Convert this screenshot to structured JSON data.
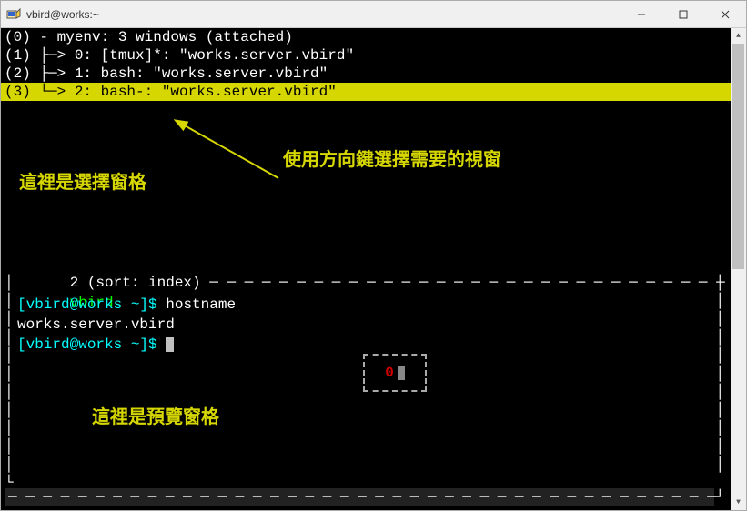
{
  "titlebar": {
    "title": "vbird@works:~"
  },
  "tmux": {
    "session_line": "(0) - myenv: 3 windows (attached)",
    "windows": [
      "(1) ├─> 0: [tmux]*: \"works.server.vbird\"",
      "(2) ├─> 1: bash: \"works.server.vbird\"",
      "(3) └─> 2: bash-: \"works.server.vbird\""
    ],
    "selected_index": 2
  },
  "annotations": {
    "select_pane": "這裡是選擇窗格",
    "arrow_hint": "使用方向鍵選擇需要的視窗",
    "preview_pane": "這裡是預覽窗格"
  },
  "preview": {
    "header_prefix": "2 (sort: index)",
    "dashes": " ─ ─ ─ ─ ─ ─ ─ ─ ─ ─ ─ ─ ─ ─ ─ ─ ─ ─ ─ ─ ─ ─ ─ ─ ─ ─ ─ ─ ─ ─ ─ ─ ─ ┐",
    "user_line": "vbird",
    "prompt1_user": "[vbird@works ~]$ ",
    "prompt1_cmd": "hostname",
    "output": "works.server.vbird",
    "prompt2": "[vbird@works ~]$ ",
    "pane_number": "0"
  },
  "status": {
    "bottom_dashes": "─ ─ ─ ─ ─ ─ ─ ─ ─ ─ ─ ─ ─ ─ ─ ─ ─ ─ ─ ─ ─ ─ ─ ─ ─ ─ ─ ─ ─ ─ ─ ─ ─ ─ ─ ─ ─ ─ ─ ─ ─",
    "right_corner": "┘"
  }
}
